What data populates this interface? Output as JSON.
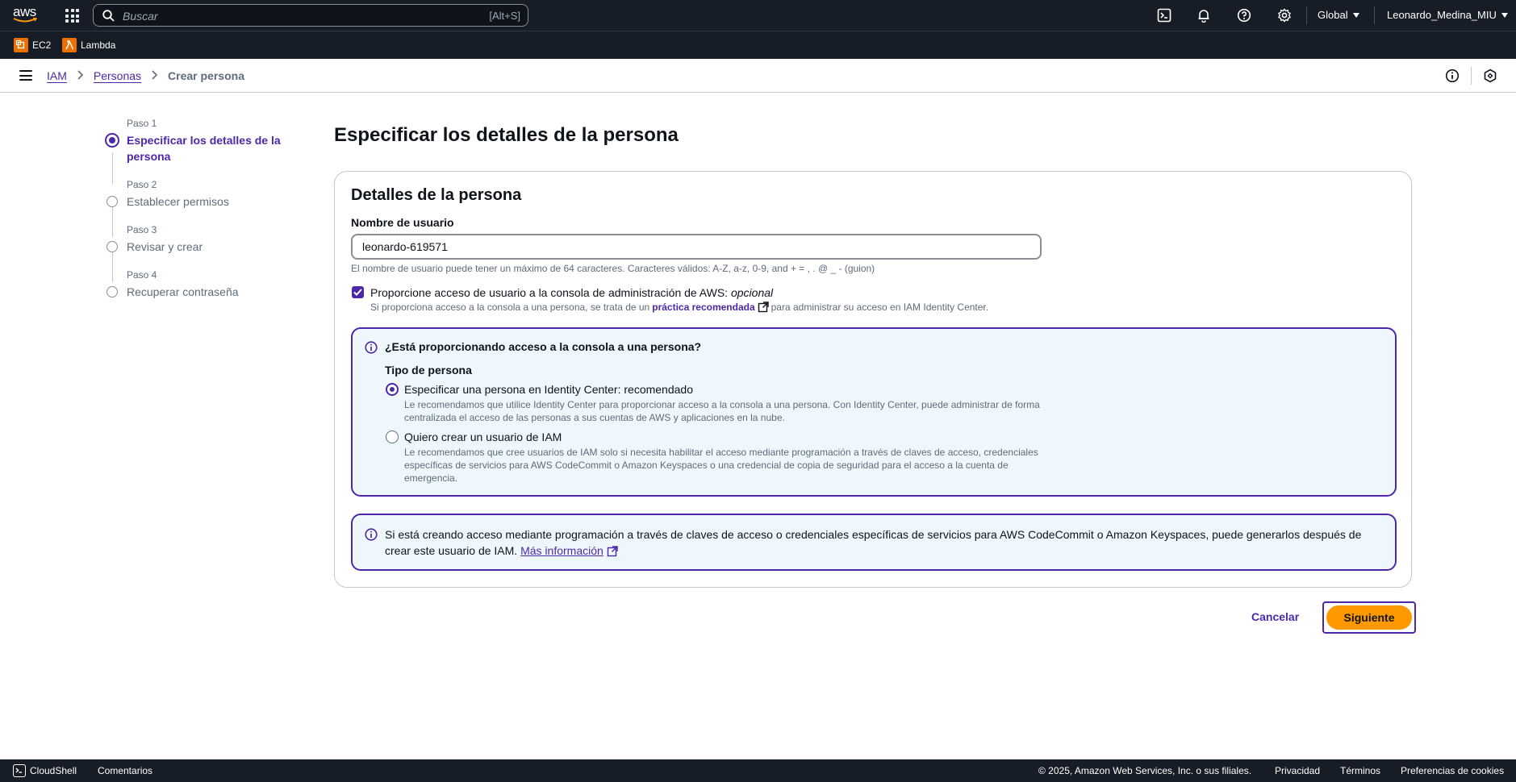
{
  "topnav": {
    "logo_text": "aws",
    "search_placeholder": "Buscar",
    "search_shortcut": "[Alt+S]",
    "region": "Global",
    "account": "Leonardo_Medina_MIU",
    "icons": [
      "cloudshell-icon",
      "bell-icon",
      "help-icon",
      "gear-icon"
    ]
  },
  "favorites": [
    {
      "label": "EC2",
      "icon": "ec2-icon"
    },
    {
      "label": "Lambda",
      "icon": "lambda-icon"
    }
  ],
  "breadcrumb": {
    "items": [
      "IAM",
      "Personas"
    ],
    "current": "Crear persona"
  },
  "steps": [
    {
      "label": "Paso 1",
      "title": "Especificar los detalles de la persona"
    },
    {
      "label": "Paso 2",
      "title": "Establecer permisos"
    },
    {
      "label": "Paso 3",
      "title": "Revisar y crear"
    },
    {
      "label": "Paso 4",
      "title": "Recuperar contraseña"
    }
  ],
  "page_title": "Especificar los detalles de la persona",
  "panel": {
    "title": "Detalles de la persona",
    "username_label": "Nombre de usuario",
    "username_value": "leonardo-619571",
    "username_hint": "El nombre de usuario puede tener un máximo de 64 caracteres. Caracteres válidos: A-Z, a-z, 0-9, and + = , . @ _ - (guion)",
    "console_checkbox": {
      "checked": true,
      "label": "Proporcione acceso de usuario a la consola de administración de AWS:",
      "label_optional": "opcional",
      "desc_before": "Si proporciona acceso a la consola a una persona, se trata de un",
      "desc_link": "práctica recomendada",
      "desc_after": "para administrar su acceso en IAM Identity Center."
    },
    "info_box": {
      "title": "¿Está proporcionando acceso a la consola a una persona?",
      "type_label": "Tipo de persona",
      "options": [
        {
          "selected": true,
          "title": "Especificar una persona en Identity Center: recomendado",
          "desc": "Le recomendamos que utilice Identity Center para proporcionar acceso a la consola a una persona. Con Identity Center, puede administrar de forma centralizada el acceso de las personas a sus cuentas de AWS y aplicaciones en la nube."
        },
        {
          "selected": false,
          "title": "Quiero crear un usuario de IAM",
          "desc": "Le recomendamos que cree usuarios de IAM solo si necesita habilitar el acceso mediante programación a través de claves de acceso, credenciales específicas de servicios para AWS CodeCommit o Amazon Keyspaces o una credencial de copia de seguridad para el acceso a la cuenta de emergencia."
        }
      ]
    },
    "info_box2": {
      "text": "Si está creando acceso mediante programación a través de claves de acceso o credenciales específicas de servicios para AWS CodeCommit o Amazon Keyspaces, puede generarlos después de crear este usuario de IAM.",
      "link": "Más información"
    }
  },
  "actions": {
    "cancel": "Cancelar",
    "next": "Siguiente"
  },
  "footer": {
    "cloudshell": "CloudShell",
    "feedback": "Comentarios",
    "copyright": "© 2025, Amazon Web Services, Inc. o sus filiales.",
    "privacy": "Privacidad",
    "terms": "Términos",
    "cookies": "Preferencias de cookies"
  },
  "colors": {
    "nav_bg": "#161d26",
    "accent": "#4d27aa",
    "primary_button": "#ff9900",
    "info_bg": "#eef8fc"
  }
}
